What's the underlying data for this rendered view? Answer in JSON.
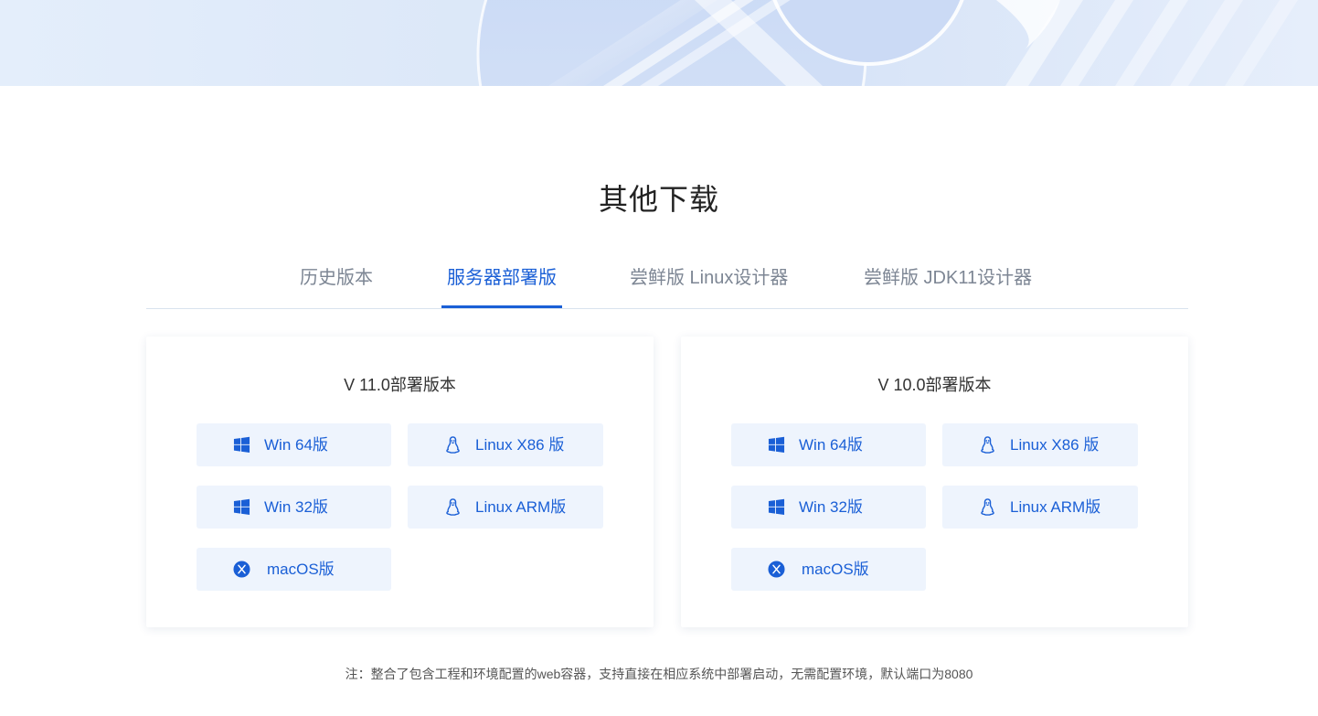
{
  "section": {
    "title": "其他下载"
  },
  "tabs": [
    {
      "label": "历史版本"
    },
    {
      "label": "服务器部署版"
    },
    {
      "label": "尝鲜版 Linux设计器"
    },
    {
      "label": "尝鲜版 JDK11设计器"
    }
  ],
  "cards": [
    {
      "title": "V 11.0部署版本",
      "buttons": [
        {
          "label": "Win 64版",
          "icon": "windows-icon"
        },
        {
          "label": "Linux X86 版",
          "icon": "linux-icon"
        },
        {
          "label": "Win 32版",
          "icon": "windows-icon"
        },
        {
          "label": "Linux ARM版",
          "icon": "linux-icon"
        },
        {
          "label": "macOS版",
          "icon": "macos-icon"
        }
      ]
    },
    {
      "title": "V 10.0部署版本",
      "buttons": [
        {
          "label": "Win 64版",
          "icon": "windows-icon"
        },
        {
          "label": "Linux X86 版",
          "icon": "linux-icon"
        },
        {
          "label": "Win 32版",
          "icon": "windows-icon"
        },
        {
          "label": "Linux ARM版",
          "icon": "linux-icon"
        },
        {
          "label": "macOS版",
          "icon": "macos-icon"
        }
      ]
    }
  ],
  "note": "注：整合了包含工程和环境配置的web容器，支持直接在相应系统中部署启动，无需配置环境，默认端口为8080",
  "colors": {
    "accent": "#1a5fd6",
    "button_bg": "#eef4fd",
    "tab_inactive": "#7d8694"
  }
}
